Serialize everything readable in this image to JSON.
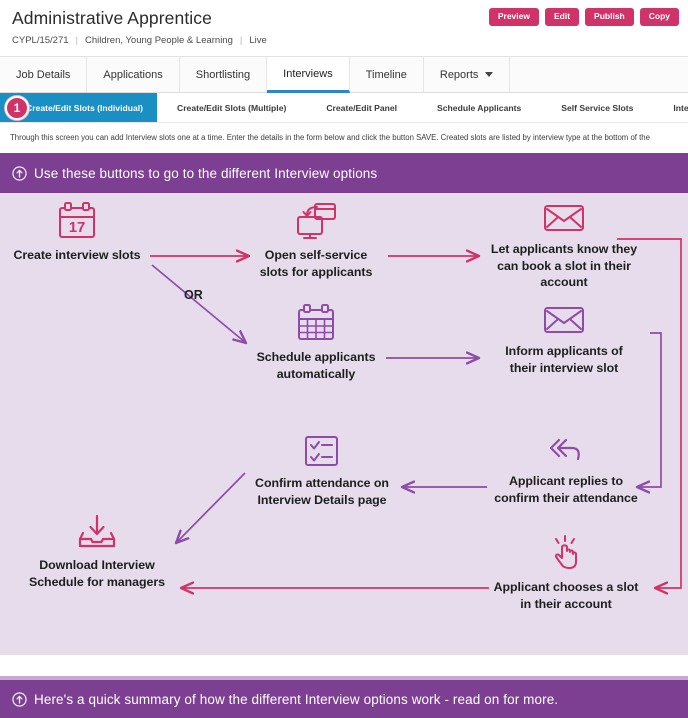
{
  "header": {
    "job_title": "Administrative Apprentice",
    "reference": "CYPL/15/271",
    "department": "Children, Young People & Learning",
    "status": "Live",
    "separator": "|",
    "actions": [
      {
        "label": "Preview",
        "name": "preview-button"
      },
      {
        "label": "Edit",
        "name": "edit-button"
      },
      {
        "label": "Publish",
        "name": "publish-button"
      },
      {
        "label": "Copy",
        "name": "copy-button"
      }
    ]
  },
  "tabs": [
    {
      "label": "Job Details",
      "active": false,
      "caret": false
    },
    {
      "label": "Applications",
      "active": false,
      "caret": false
    },
    {
      "label": "Shortlisting",
      "active": false,
      "caret": false
    },
    {
      "label": "Interviews",
      "active": true,
      "caret": false
    },
    {
      "label": "Timeline",
      "active": false,
      "caret": false
    },
    {
      "label": "Reports",
      "active": false,
      "caret": true
    }
  ],
  "subtabs": {
    "badge": "1",
    "items": [
      {
        "label": "Create/Edit Slots (Individual)",
        "active": true
      },
      {
        "label": "Create/Edit Slots (Multiple)",
        "active": false
      },
      {
        "label": "Create/Edit Panel",
        "active": false
      },
      {
        "label": "Schedule Applicants",
        "active": false
      },
      {
        "label": "Self Service Slots",
        "active": false
      },
      {
        "label": "Interview Details",
        "active": false
      }
    ]
  },
  "description": "Through this screen you can add Interview slots one at a time. Enter the details in the form below and click the button SAVE. Created slots are listed by interview type at the bottom of the",
  "banners": {
    "top": "Use these buttons to go to the different Interview options",
    "bottom": "Here's a quick summary of how the different Interview options work - read on for more."
  },
  "colors": {
    "pink": "#cf3368",
    "purple": "#8e4ba8",
    "banner_purple": "#7d3f92",
    "active_subtab_blue": "#1a8fc4",
    "active_tab_underline": "#2e86c8",
    "flow_background": "#e6dcec"
  },
  "flow": {
    "nodes": [
      {
        "id": "create-slots",
        "icon": "calendar-17-icon",
        "color": "#cf3368",
        "label": "Create interview slots"
      },
      {
        "id": "open-self-service",
        "icon": "self-service-icon",
        "color": "#cf3368",
        "label": "Open self-service\nslots for applicants"
      },
      {
        "id": "let-applicants",
        "icon": "envelope-icon",
        "color": "#cf3368",
        "label": "Let applicants know they\ncan book a slot in their\naccount"
      },
      {
        "id": "schedule-auto",
        "icon": "calendar-grid-icon",
        "color": "#8e4ba8",
        "label": "Schedule applicants\nautomatically"
      },
      {
        "id": "inform-applicants",
        "icon": "envelope-icon",
        "color": "#8e4ba8",
        "label": "Inform applicants of\ntheir interview slot"
      },
      {
        "id": "applicant-replies",
        "icon": "reply-arrow-icon",
        "color": "#8e4ba8",
        "label": "Applicant replies to\nconfirm their attendance"
      },
      {
        "id": "confirm-attendance",
        "icon": "checklist-icon",
        "color": "#8e4ba8",
        "label": "Confirm attendance on\nInterview Details page"
      },
      {
        "id": "applicant-chooses",
        "icon": "click-hand-icon",
        "color": "#cf3368",
        "label": "Applicant chooses a slot\nin their account"
      },
      {
        "id": "download-schedule",
        "icon": "download-tray-icon",
        "color": "#cf3368",
        "label": "Download Interview\nSchedule for managers"
      }
    ],
    "or_label": "OR"
  }
}
